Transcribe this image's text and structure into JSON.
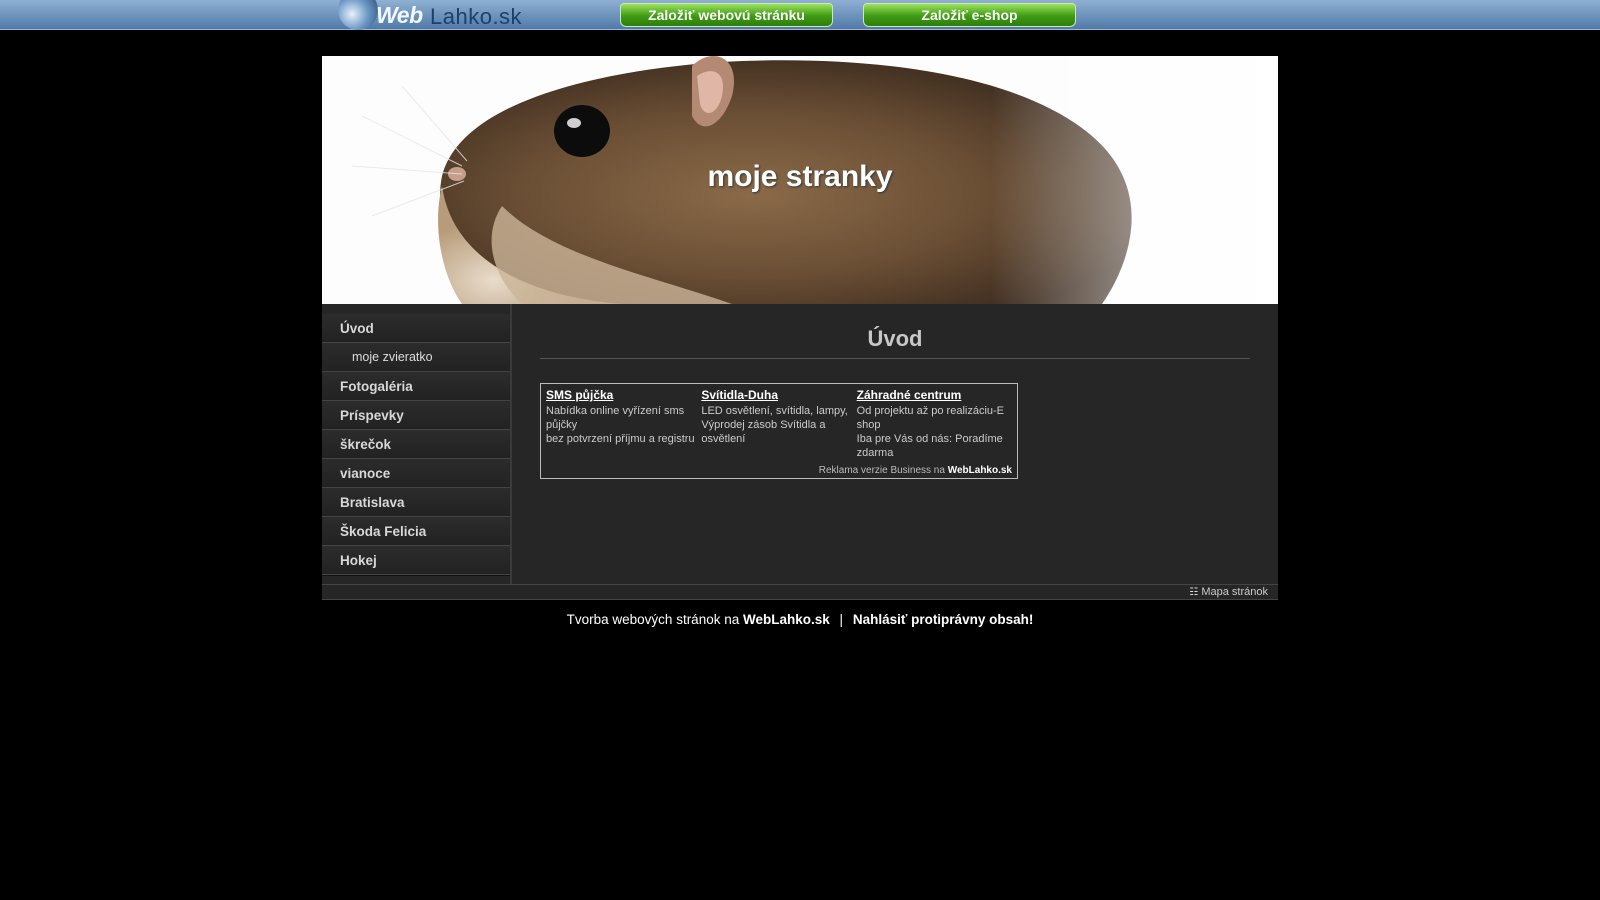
{
  "topbar": {
    "logo_web": "Web",
    "logo_rest": "Lahko.sk",
    "btn_web": "Založiť webovú stránku",
    "btn_shop": "Založiť e-shop"
  },
  "header": {
    "title": "moje stranky"
  },
  "sidebar": {
    "items": [
      {
        "label": "Úvod"
      },
      {
        "label": "moje zvieratko"
      },
      {
        "label": "Fotogaléria"
      },
      {
        "label": "Príspevky"
      },
      {
        "label": "škrečok"
      },
      {
        "label": "vianoce"
      },
      {
        "label": "Bratislava"
      },
      {
        "label": "Škoda Felicia"
      },
      {
        "label": "Hokej"
      }
    ]
  },
  "main": {
    "heading": "Úvod",
    "ads": [
      {
        "title": "SMS půjčka",
        "text": "Nabídka online vyřízení sms půjčky\nbez potvrzení příjmu a registru"
      },
      {
        "title": "Svítidla-Duha",
        "text": "LED osvětlení, svítidla, lampy, Výprodej zásob Svítidla a osvětlení"
      },
      {
        "title": "Záhradné centrum",
        "text": "Od projektu až po realizáciu-E shop\nIba pre Vás od nás: Poradíme zdarma"
      }
    ],
    "ads_footer_prefix": "Reklama verzie Business na",
    "ads_footer_brand": "WebLahko.sk"
  },
  "footer": {
    "sitemap": "Mapa stránok",
    "bottom_prefix": "Tvorba webových stránok na",
    "bottom_brand": "WebLahko.sk",
    "separator": "|",
    "report": "Nahlásiť protiprávny obsah!"
  }
}
